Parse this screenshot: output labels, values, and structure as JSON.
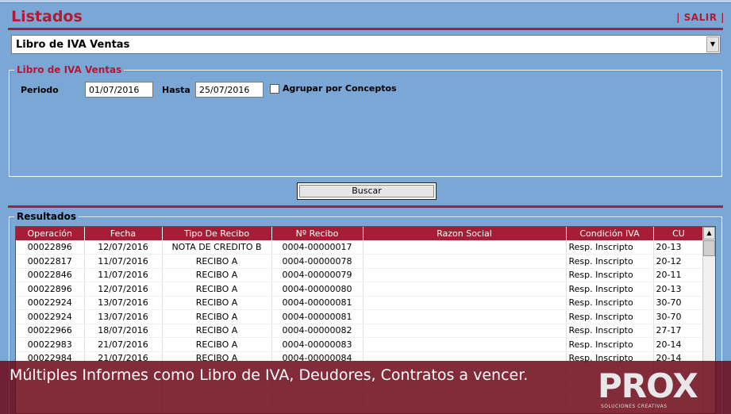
{
  "header": {
    "title": "Listados",
    "salir_label": "| SALIR |"
  },
  "report_select": {
    "value": "Libro de IVA Ventas"
  },
  "filters": {
    "group_label": "Libro de IVA Ventas",
    "periodo_label": "Periodo",
    "periodo_value": "01/07/2016",
    "hasta_label": "Hasta",
    "hasta_value": "25/07/2016",
    "agrupar_label": "Agrupar por Conceptos"
  },
  "buscar_label": "Buscar",
  "results": {
    "group_label": "Resultados",
    "columns": [
      "Operación",
      "Fecha",
      "Tipo De Recibo",
      "Nº Recibo",
      "Razon Social",
      "Condición IVA",
      "CU"
    ],
    "rows": [
      [
        "00022896",
        "12/07/2016",
        "NOTA DE CREDITO B",
        "0004-00000017",
        "",
        "Resp. Inscripto",
        "20-13"
      ],
      [
        "00022817",
        "11/07/2016",
        "RECIBO A",
        "0004-00000078",
        "",
        "Resp. Inscripto",
        "20-12"
      ],
      [
        "00022846",
        "11/07/2016",
        "RECIBO A",
        "0004-00000079",
        "",
        "Resp. Inscripto",
        "20-11"
      ],
      [
        "00022896",
        "12/07/2016",
        "RECIBO A",
        "0004-00000080",
        "",
        "Resp. Inscripto",
        "20-13"
      ],
      [
        "00022924",
        "13/07/2016",
        "RECIBO A",
        "0004-00000081",
        "",
        "Resp. Inscripto",
        "30-70"
      ],
      [
        "00022924",
        "13/07/2016",
        "RECIBO A",
        "0004-00000081",
        "",
        "Resp. Inscripto",
        "30-70"
      ],
      [
        "00022966",
        "18/07/2016",
        "RECIBO A",
        "0004-00000082",
        "",
        "Resp. Inscripto",
        "27-17"
      ],
      [
        "00022983",
        "21/07/2016",
        "RECIBO A",
        "0004-00000083",
        "",
        "Resp. Inscripto",
        "20-14"
      ],
      [
        "00022984",
        "21/07/2016",
        "RECIBO A",
        "0004-00000084",
        "",
        "Resp. Inscripto",
        "20-14"
      ],
      [
        "",
        "",
        "",
        "",
        "",
        "",
        ""
      ],
      [
        "",
        "",
        "",
        "",
        "",
        "",
        ""
      ],
      [
        "",
        "",
        "",
        "",
        "",
        "",
        ""
      ],
      [
        "",
        "",
        "",
        "",
        "",
        "",
        ""
      ]
    ]
  },
  "banner": {
    "text": "Múltiples Informes como Libro de IVA, Deudores, Contratos a vencer."
  },
  "logo": {
    "text": "PROX",
    "subtitle": "SOLUCIONES CREATIVAS"
  },
  "colors": {
    "accent": "#b01a34",
    "background": "#7ba7d7",
    "header_row": "#a61e35"
  }
}
